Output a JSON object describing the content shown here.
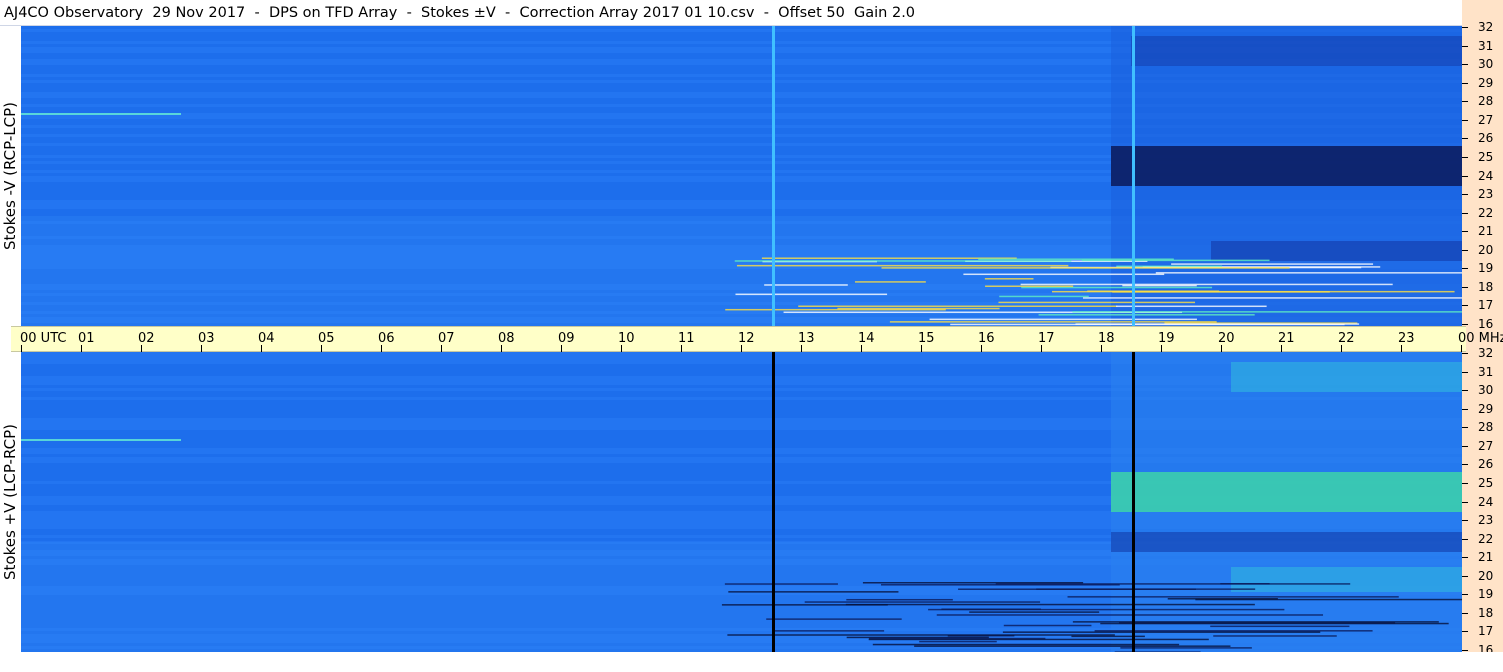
{
  "title": "AJ4CO Observatory  29 Nov 2017  -  DPS on TFD Array  -  Stokes ±V  -  Correction Array 2017 01 10.csv  -  Offset 50  Gain 2.0",
  "panels": {
    "top": {
      "ylabel": "Stokes -V (RCP-LCP)"
    },
    "bottom": {
      "ylabel": "Stokes +V (LCP-RCP)"
    }
  },
  "time_axis": {
    "labels": [
      "00 UTC",
      "01",
      "02",
      "03",
      "04",
      "05",
      "06",
      "07",
      "08",
      "09",
      "10",
      "11",
      "12",
      "13",
      "14",
      "15",
      "16",
      "17",
      "18",
      "19",
      "20",
      "21",
      "22",
      "23",
      "00 MHz"
    ]
  },
  "freq_axis": {
    "labels": [
      "32",
      "31",
      "30",
      "29",
      "28",
      "27",
      "26",
      "25",
      "24",
      "23",
      "22",
      "21",
      "20",
      "19",
      "18",
      "17",
      "16"
    ]
  },
  "colors": {
    "background_blue": "#1f72f0",
    "time_axis_bg": "#ffffc8",
    "freq_axis_bg": "#ffe3c8",
    "dark_band": "#0a1a5a",
    "bright_band": "#40e0a0"
  }
}
